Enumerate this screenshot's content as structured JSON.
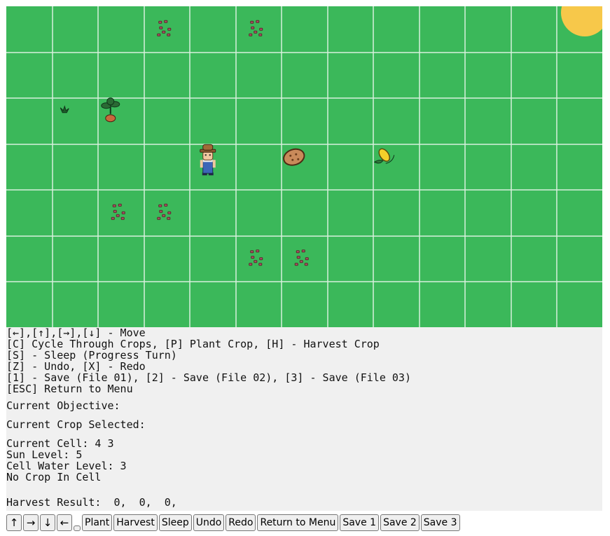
{
  "game": {
    "grid_color": "#3bb85a",
    "grid_line_color": "#d8f0dc",
    "sun_color": "#f7c84a",
    "tiles": [
      {
        "type": "seeds-icon",
        "col": 3,
        "row": 0
      },
      {
        "type": "seeds-icon",
        "col": 5,
        "row": 0
      },
      {
        "type": "sprout-icon",
        "col": 1,
        "row": 2
      },
      {
        "type": "plant-icon",
        "col": 2,
        "row": 2
      },
      {
        "type": "farmer-icon",
        "col": 4,
        "row": 3
      },
      {
        "type": "potato-icon",
        "col": 6,
        "row": 3
      },
      {
        "type": "corn-icon",
        "col": 8,
        "row": 3
      },
      {
        "type": "seeds-icon",
        "col": 2,
        "row": 4
      },
      {
        "type": "seeds-icon",
        "col": 3,
        "row": 4
      },
      {
        "type": "seeds-icon",
        "col": 5,
        "row": 5
      },
      {
        "type": "seeds-icon",
        "col": 6,
        "row": 5
      }
    ]
  },
  "info": {
    "controls": [
      "[←],[↑],[→],[↓] - Move",
      "[C] Cycle Through Crops, [P] Plant Crop, [H] - Harvest Crop",
      "[S] - Sleep (Progress Turn)",
      "[Z] - Undo, [X] - Redo",
      "[1] - Save (File 01), [2] - Save (File 02), [3] - Save (File 03)",
      "[ESC] Return to Menu"
    ],
    "objective_label": "Current Objective:",
    "crop_selected_label": "Current Crop Selected:",
    "current_cell": "Current Cell: 4 3",
    "sun_level": "Sun Level: 5",
    "water_level": "Cell Water Level: 3",
    "crop_status": "No Crop In Cell",
    "harvest_result": "Harvest Result:  0,  0,  0,"
  },
  "buttons": {
    "up": "↑",
    "right": "→",
    "down": "↓",
    "left": "←",
    "plant": "Plant",
    "harvest": "Harvest",
    "sleep": "Sleep",
    "undo": "Undo",
    "redo": "Redo",
    "menu": "Return to Menu",
    "save1": "Save 1",
    "save2": "Save 2",
    "save3": "Save 3"
  }
}
